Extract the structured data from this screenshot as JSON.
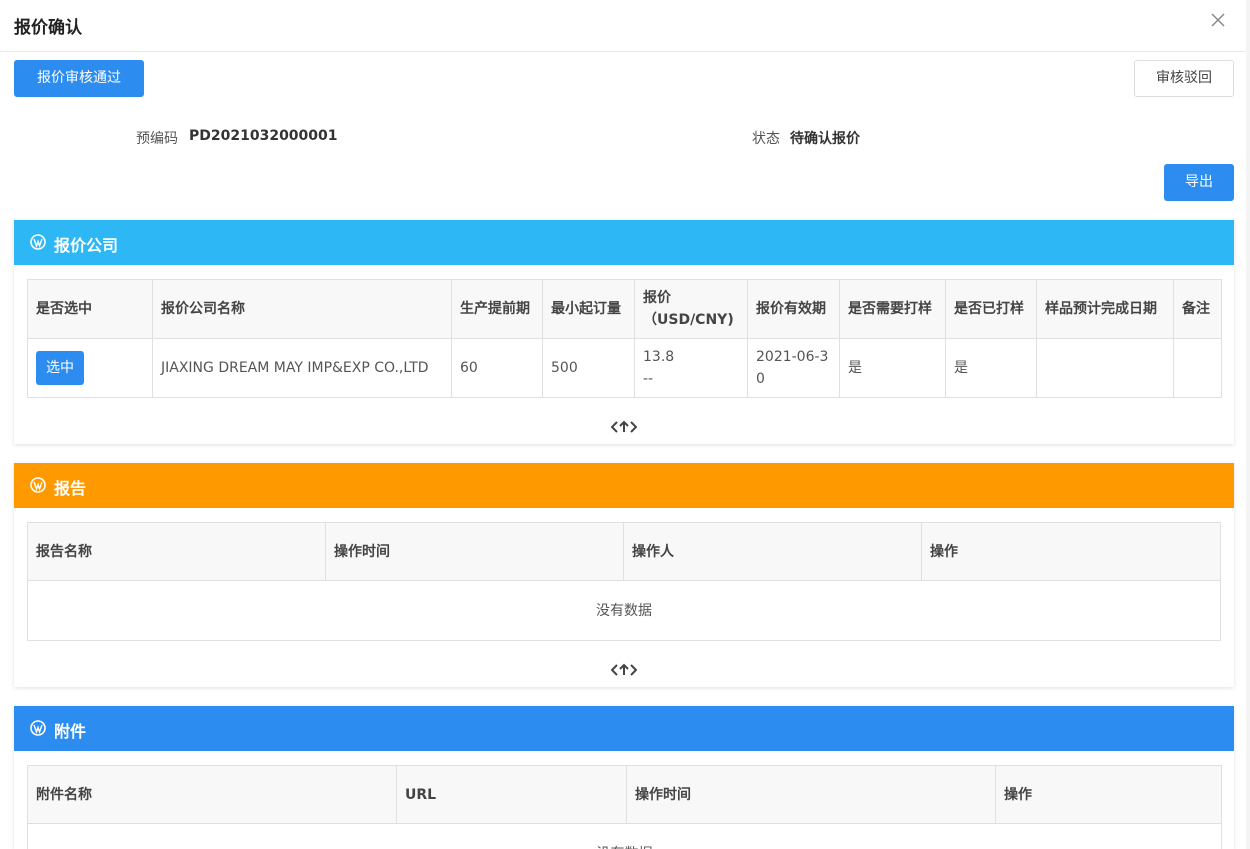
{
  "modal": {
    "title": "报价确认"
  },
  "toolbar": {
    "approve_label": "报价审核通过",
    "reject_label": "审核驳回",
    "export_label": "导出"
  },
  "info": {
    "code_label": "预编码",
    "code_value": "PD2021032000001",
    "status_label": "状态",
    "status_value": "待确认报价"
  },
  "colors": {
    "primary": "#2d8cf0",
    "company_header": "#2db7f5",
    "report_header": "#ff9900",
    "attachment_header": "#2d8cf0"
  },
  "company_panel": {
    "title": "报价公司",
    "columns": [
      "是否选中",
      "报价公司名称",
      "生产提前期",
      "最小起订量",
      "报价（USD/CNY)",
      "报价有效期",
      "是否需要打样",
      "是否已打样",
      "样品预计完成日期",
      "备注"
    ],
    "rows": [
      {
        "select_label": "选中",
        "company": "JIAXING DREAM MAY IMP&EXP CO.,LTD",
        "lead_time": "60",
        "moq": "500",
        "price_usd": "13.8",
        "price_cny": "--",
        "valid_until": "2021-06-30",
        "need_sample": "是",
        "sampled": "是",
        "sample_date": "",
        "remark": ""
      }
    ]
  },
  "report_panel": {
    "title": "报告",
    "columns": [
      "报告名称",
      "操作时间",
      "操作人",
      "操作"
    ],
    "empty_text": "没有数据"
  },
  "attachment_panel": {
    "title": "附件",
    "columns": [
      "附件名称",
      "URL",
      "操作时间",
      "操作"
    ],
    "empty_text": "没有数据"
  }
}
